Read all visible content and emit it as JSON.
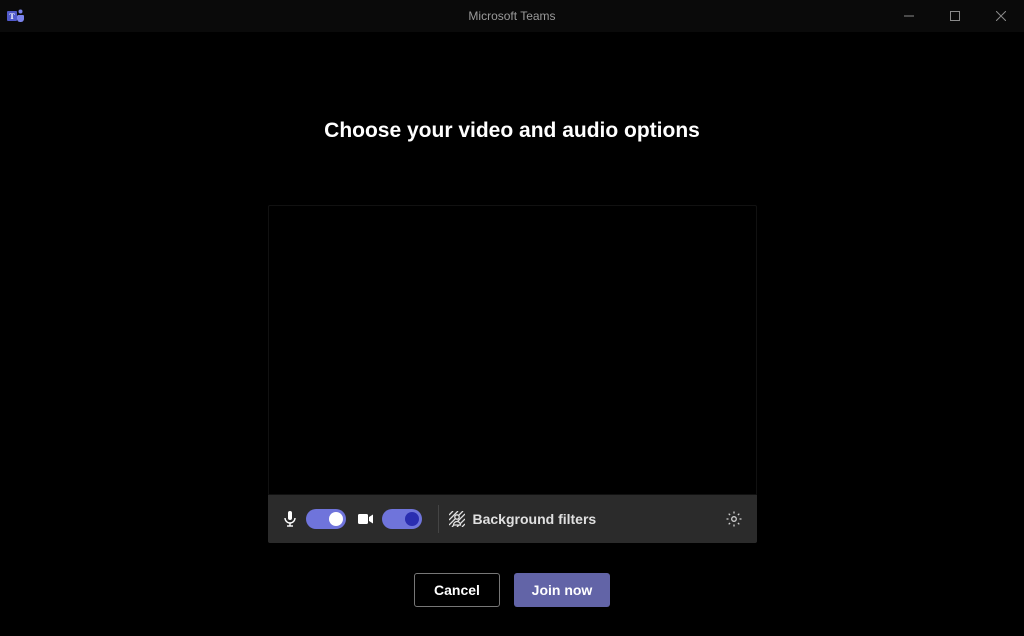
{
  "window": {
    "title": "Microsoft Teams"
  },
  "heading": "Choose your video and audio options",
  "controls": {
    "mic_icon": "microphone-icon",
    "mic_on": true,
    "cam_icon": "video-camera-icon",
    "cam_on": true,
    "background_filters_label": "Background filters",
    "settings_icon": "gear-icon"
  },
  "actions": {
    "cancel_label": "Cancel",
    "join_label": "Join now"
  },
  "colors": {
    "accent": "#6264A7",
    "toggle_on": "#6f74db",
    "control_bar_bg": "#2b2b2b"
  }
}
